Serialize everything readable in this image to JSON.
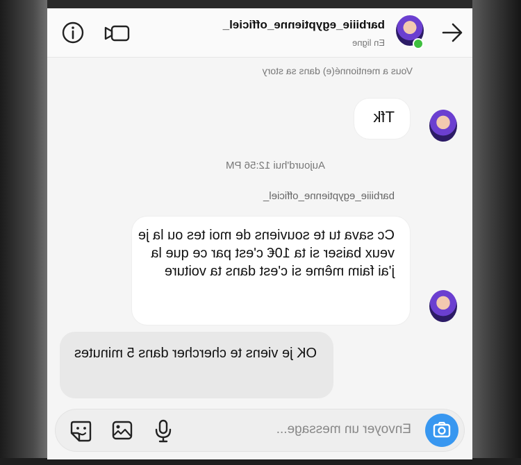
{
  "header": {
    "username": "barbiiie_egyptienne_officiel_",
    "status": "En ligne"
  },
  "notice": "Vous a mentionné(e) dans sa story",
  "messages": [
    {
      "from": "them",
      "text": "Tfk"
    },
    {
      "timestamp": "Aujourd'hui 12:56 PM"
    },
    {
      "from": "them",
      "sender": "barbiiie_egyptienne_officiel_",
      "text": "Cc sava tu te souviens de moi tes ou la je veux baiser si ta 10€ c'est par ce que la j'ai faim  même si c'est dans ta voiture"
    },
    {
      "from": "me",
      "text": "OK je viens te chercher dans 5 minutes"
    }
  ],
  "composer": {
    "placeholder": "Envoyer un message..."
  },
  "icons": {
    "back": "arrow-back-icon",
    "video": "video-call-icon",
    "info": "info-icon",
    "camera": "camera-icon",
    "mic": "microphone-icon",
    "gallery": "gallery-icon",
    "sticker": "sticker-icon"
  },
  "colors": {
    "accent": "#3897f0",
    "online": "#3fbf3f"
  }
}
